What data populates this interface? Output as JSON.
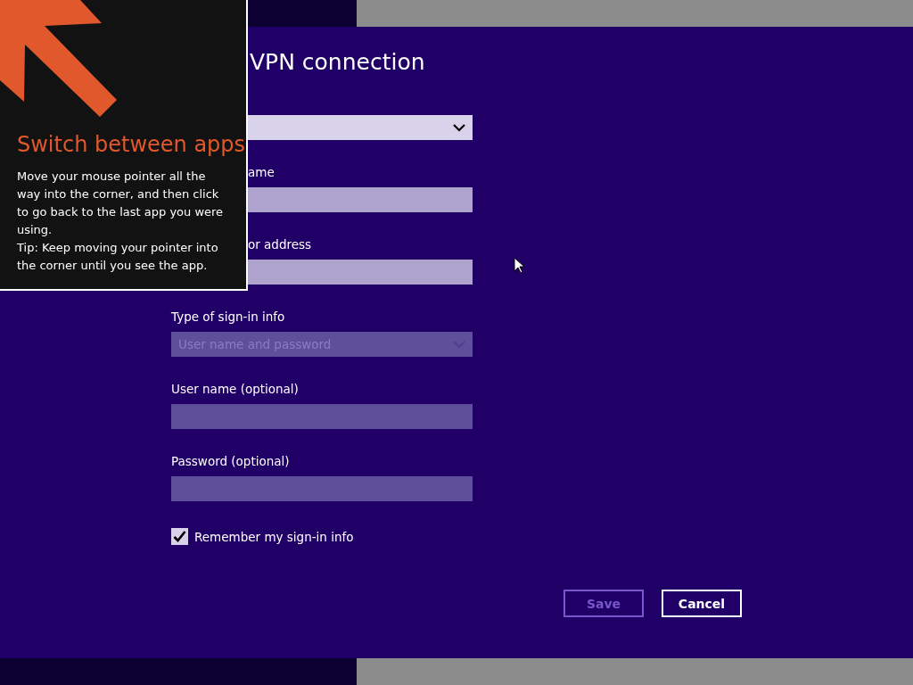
{
  "overlay": {
    "title": "Switch between apps",
    "body": [
      "Move your mouse pointer all the way into the corner, and then click to go back to the last app you were using.",
      "Tip: Keep moving your pointer into the corner until you see the app."
    ]
  },
  "page": {
    "title": "VPN connection"
  },
  "fields": [
    {
      "kind": "dropdown",
      "cut_by_overlay": true,
      "disabled": false
    },
    {
      "kind": "text",
      "label": "ame",
      "cut_by_overlay": true,
      "disabled": false
    },
    {
      "kind": "text",
      "label": "or address",
      "cut_by_overlay": true,
      "disabled": false
    },
    {
      "kind": "dropdown",
      "label": "Type of sign-in info",
      "value": "User name and password",
      "cut_by_overlay": false,
      "disabled": true
    },
    {
      "kind": "text",
      "label": "User name (optional)",
      "cut_by_overlay": false,
      "disabled": true
    },
    {
      "kind": "text",
      "label": "Password (optional)",
      "cut_by_overlay": false,
      "disabled": true
    }
  ],
  "remember": {
    "label": "Remember my sign-in info",
    "checked": true
  },
  "buttons": [
    {
      "label": "Save",
      "disabled": true
    },
    {
      "label": "Cancel",
      "disabled": false
    }
  ]
}
